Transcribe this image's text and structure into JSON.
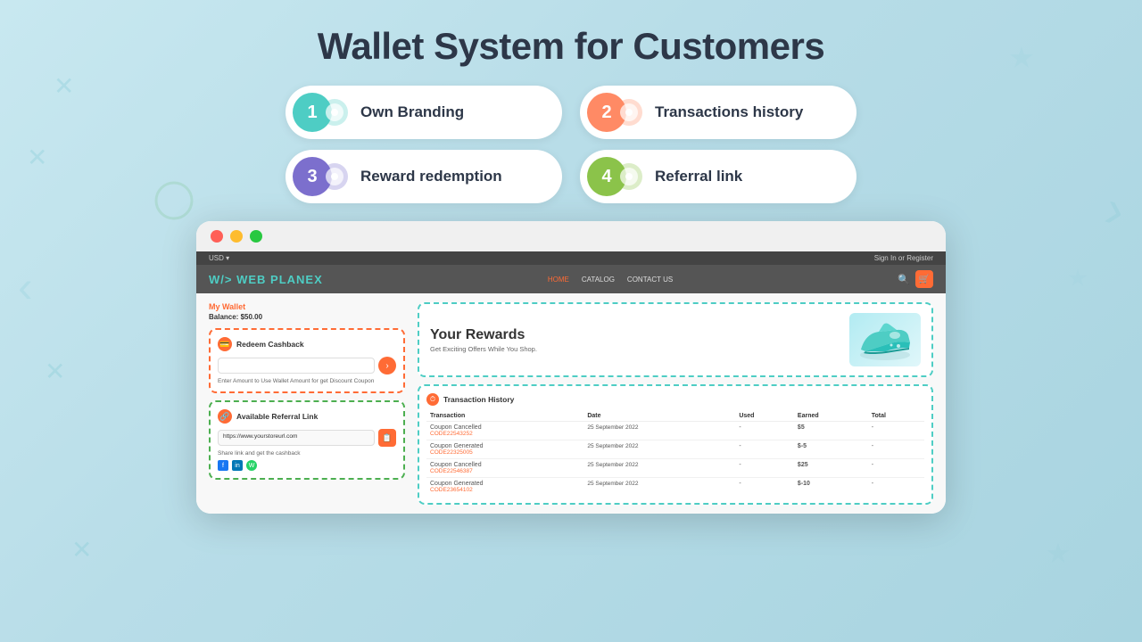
{
  "page": {
    "title": "Wallet System for Customers"
  },
  "features": [
    {
      "number": "1",
      "label": "Own Branding",
      "color": "#4ecdc4",
      "textColor": "white"
    },
    {
      "number": "2",
      "label": "Transactions history",
      "color": "#ff8a65",
      "textColor": "white"
    },
    {
      "number": "3",
      "label": "Reward redemption",
      "color": "#7c6fcd",
      "textColor": "white"
    },
    {
      "number": "4",
      "label": "Referral link",
      "color": "#8bc34a",
      "textColor": "white"
    }
  ],
  "browser": {
    "storeTopBar": {
      "currency": "USD ▾",
      "auth": "Sign In  or  Register"
    },
    "storeLogo": "W/> WEB PLANEX",
    "storeNav": [
      "HOME",
      "CATALOG",
      "CONTACT US"
    ],
    "activeNav": "HOME"
  },
  "wallet": {
    "title": "My Wallet",
    "balance": "Balance: $50.00"
  },
  "redeemCard": {
    "title": "Redeem Cashback",
    "inputPlaceholder": "",
    "hint": "Enter Amount to Use Wallet Amount for get Discount Coupon",
    "buttonLabel": "›"
  },
  "referralCard": {
    "title": "Available Referral Link",
    "url": "https://www.yourstoreurl.com",
    "hint": "Share link and get the cashback",
    "socialColors": [
      "#1877f2",
      "#0077b5",
      "#25d366"
    ]
  },
  "rewardsBanner": {
    "heading": "Your Rewards",
    "subtext": "Get Exciting Offers While You Shop."
  },
  "transactionHistory": {
    "title": "Transaction History",
    "columns": [
      "Transaction",
      "Date",
      "Used",
      "Earned",
      "Total"
    ],
    "rows": [
      {
        "name": "Coupon Cancelled",
        "code": "CODE22543252",
        "date": "25 September 2022",
        "used": "-",
        "earned": "$5",
        "total": "-",
        "earnedClass": "earned-positive"
      },
      {
        "name": "Coupon Generated",
        "code": "CODE22325005",
        "date": "25 September 2022",
        "used": "-",
        "earned": "$-5",
        "total": "-",
        "earnedClass": "earned-negative"
      },
      {
        "name": "Coupon Cancelled",
        "code": "CODE22546387",
        "date": "25 September 2022",
        "used": "-",
        "earned": "$25",
        "total": "-",
        "earnedClass": "earned-positive"
      },
      {
        "name": "Coupon Generated",
        "code": "CODE23654102",
        "date": "25 September 2022",
        "used": "-",
        "earned": "$-10",
        "total": "-",
        "earnedClass": "earned-negative"
      }
    ]
  }
}
